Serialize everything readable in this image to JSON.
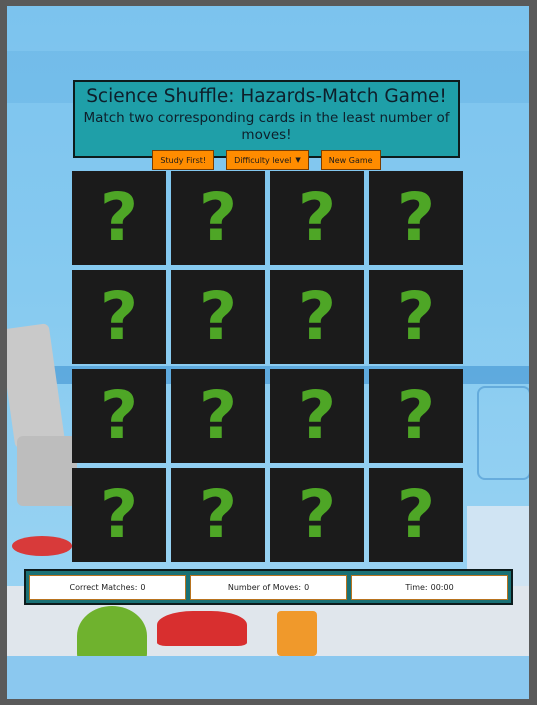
{
  "header": {
    "title": "Science Shuffle: Hazards-Match Game!",
    "subtitle": "Match two corresponding cards in the least number of moves!"
  },
  "controls": {
    "study_label": "Study First!",
    "difficulty_label": "Difficulty level",
    "new_game_label": "New Game"
  },
  "board": {
    "rows": 4,
    "cols": 4,
    "card_face": "?",
    "cards_face_down": 16
  },
  "stats": {
    "matches_label": "Correct Matches:",
    "matches_value": "0",
    "moves_label": "Number of Moves:",
    "moves_value": "0",
    "time_label": "Time:",
    "time_value": "00:00"
  },
  "colors": {
    "header_bg": "#1f9fa8",
    "button_bg": "#ff8c00",
    "card_bg": "#1b1b1b",
    "question_mark": "#4ea626",
    "stats_bg": "#1a7175"
  }
}
